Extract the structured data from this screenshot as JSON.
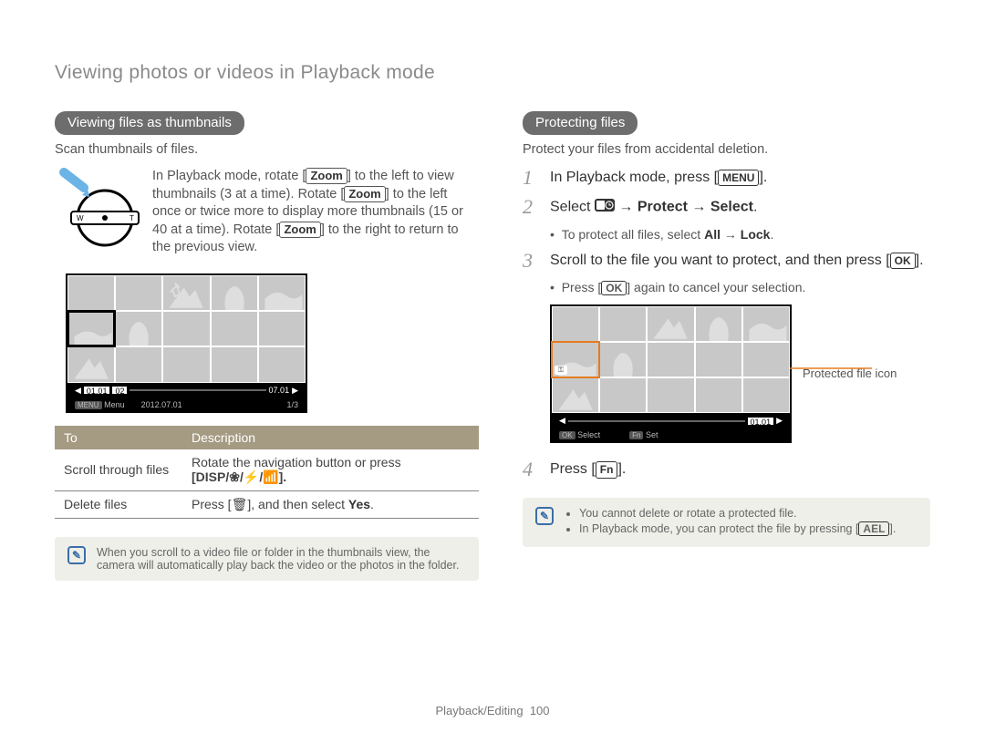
{
  "page_title": "Viewing photos or videos in Playback mode",
  "left": {
    "heading": "Viewing files as thumbnails",
    "sub": "Scan thumbnails of files.",
    "zoom_text_1": "In Playback mode, rotate [",
    "zoom_label": "Zoom",
    "zoom_text_2": "] to the left to view thumbnails (3 at a time). Rotate [",
    "zoom_text_3": "] to the left once or twice more to display more thumbnails (15 or 40 at a time). Rotate [",
    "zoom_text_4": "] to the right to return to the previous view.",
    "timeline": {
      "seg1": "01.01",
      "seg2": "02",
      "end": "07.01"
    },
    "illus_bar": {
      "menu": "Menu",
      "date": "2012.07.01",
      "page": "1/3"
    },
    "table": {
      "h1": "To",
      "h2": "Description",
      "r1c1": "Scroll through files",
      "r1c2a": "Rotate the navigation button or press",
      "r1c2b": "[DISP/‣/⚡/⨁].",
      "r2c1": "Delete files",
      "r2c2a": "Press [",
      "r2c2b": "], and then select ",
      "r2c2c": "Yes",
      "trash": "🗑"
    },
    "note": "When you scroll to a video file or folder in the thumbnails view, the camera will automatically play back the video or the photos in the folder."
  },
  "right": {
    "heading": "Protecting files",
    "sub": "Protect your files from accidental deletion.",
    "step1a": "In Playback mode, press [",
    "step1b": "].",
    "menu": "MENU",
    "step2a": "Select ",
    "step2b": " → ",
    "step2_protect": "Protect",
    "step2_select": "Select",
    "step2_period": ".",
    "step2_sub_a": "To protect all files, select ",
    "step2_sub_b": "All",
    "step2_sub_c": " → ",
    "step2_sub_d": "Lock",
    "step3": "Scroll to the file you want to protect, and then press [",
    "ok": "OK",
    "step3b": "].",
    "step3_sub_a": "Press [",
    "step3_sub_b": "] again to cancel your selection.",
    "prot_label": "Protected file icon",
    "timeline_end": "01.01",
    "illus_bar": {
      "ok": "OK",
      "select": "Select",
      "fn": "Fn",
      "set": "Set"
    },
    "step4a": "Press [",
    "step4b": "].",
    "fn": "Fn",
    "note1": "You cannot delete or rotate a protected file.",
    "note2a": "In Playback mode, you can protect the file by pressing [",
    "note2b": "].",
    "ael": "AEL"
  },
  "footer": {
    "section": "Playback/Editing",
    "page": "100"
  }
}
